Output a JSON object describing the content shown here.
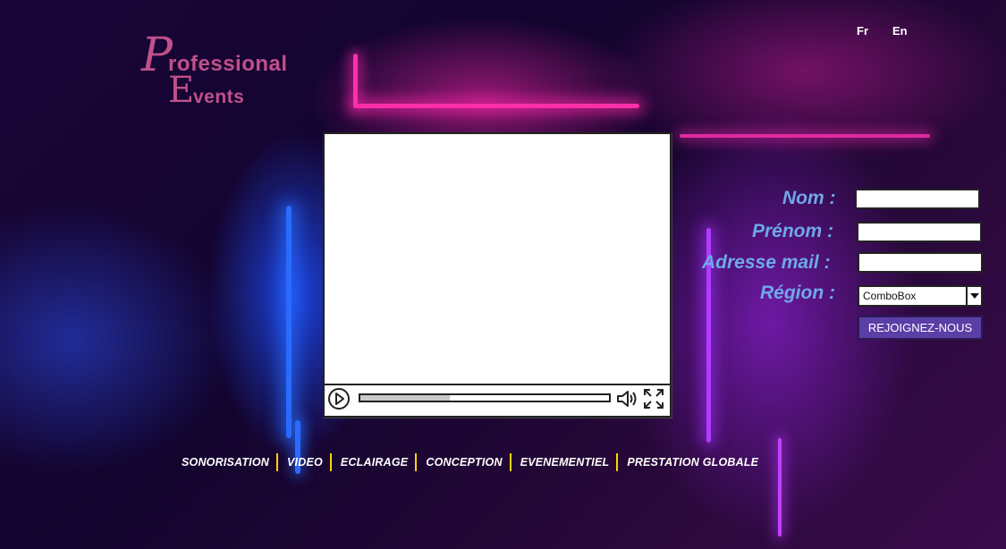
{
  "lang_switch": {
    "fr": "Fr",
    "en": "En"
  },
  "logo": {
    "initial_p": "P",
    "word1": "rofessional",
    "initial_e": "E",
    "word2": "vents"
  },
  "video": {
    "progress": 0.36
  },
  "form": {
    "nom_label": "Nom :",
    "prenom_label": "Prénom :",
    "email_label": "Adresse mail :",
    "region_label": "Région :",
    "nom_value": "",
    "prenom_value": "",
    "email_value": "",
    "region_value": "ComboBox",
    "submit_label": "REJOIGNEZ-NOUS"
  },
  "nav": {
    "items": [
      "SONORISATION",
      "VIDEO",
      "ECLAIRAGE",
      "CONCEPTION",
      "EVENEMENTIEL",
      "PRESTATION GLOBALE"
    ]
  },
  "colors": {
    "label_blue": "#6fa8e8",
    "logo_pink": "#c0508a",
    "button_purple": "#5b3fa6",
    "nav_separator": "#ffd400"
  }
}
